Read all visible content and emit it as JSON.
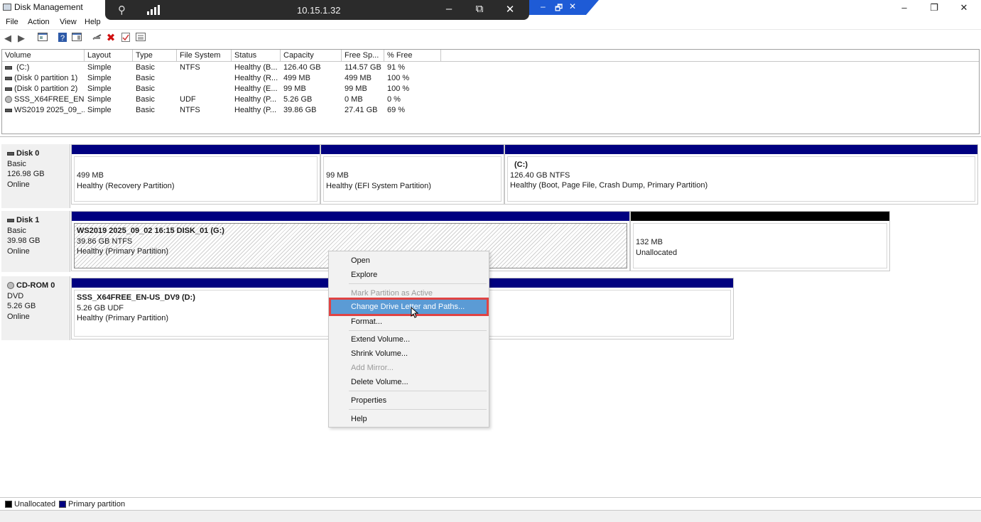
{
  "window": {
    "title": "Disk Management",
    "minimize": "–",
    "maximize": "❐",
    "close": "✕"
  },
  "remote_bar": {
    "host": "10.15.1.32",
    "pin_icon": "unpin-icon",
    "signal_icon": "signal-strength-icon",
    "minimize": "–",
    "restore": "⧉",
    "close": "✕"
  },
  "remote_tab": {
    "minimize": "–",
    "restore": "🗗",
    "close": "✕"
  },
  "menu": {
    "file": "File",
    "action": "Action",
    "view": "View",
    "help": "Help"
  },
  "toolbar": {
    "back": "◀",
    "forward": "▶",
    "delete": "✖"
  },
  "volume_list": {
    "headers": [
      "Volume",
      "Layout",
      "Type",
      "File System",
      "Status",
      "Capacity",
      "Free Sp...",
      "% Free"
    ],
    "rows": [
      {
        "volume": "(C:)",
        "layout": "Simple",
        "type": "Basic",
        "fs": "NTFS",
        "status": "Healthy (B...",
        "capacity": "126.40 GB",
        "free": "114.57 GB",
        "pct": "91 %"
      },
      {
        "volume": "(Disk 0 partition 1)",
        "layout": "Simple",
        "type": "Basic",
        "fs": "",
        "status": "Healthy (R...",
        "capacity": "499 MB",
        "free": "499 MB",
        "pct": "100 %"
      },
      {
        "volume": "(Disk 0 partition 2)",
        "layout": "Simple",
        "type": "Basic",
        "fs": "",
        "status": "Healthy (E...",
        "capacity": "99 MB",
        "free": "99 MB",
        "pct": "100 %"
      },
      {
        "volume": "SSS_X64FREE_EN-...",
        "layout": "Simple",
        "type": "Basic",
        "fs": "UDF",
        "status": "Healthy (P...",
        "capacity": "5.26 GB",
        "free": "0 MB",
        "pct": "0 %"
      },
      {
        "volume": "WS2019 2025_09_...",
        "layout": "Simple",
        "type": "Basic",
        "fs": "NTFS",
        "status": "Healthy (P...",
        "capacity": "39.86 GB",
        "free": "27.41 GB",
        "pct": "69 %"
      }
    ]
  },
  "disks": {
    "disk0": {
      "name": "Disk 0",
      "type": "Basic",
      "size": "126.98 GB",
      "state": "Online",
      "p1": {
        "size": "499 MB",
        "status": "Healthy (Recovery Partition)"
      },
      "p2": {
        "size": "99 MB",
        "status": "Healthy (EFI System Partition)"
      },
      "p3": {
        "name": "(C:)",
        "size": "126.40 GB NTFS",
        "status": "Healthy (Boot, Page File, Crash Dump, Primary Partition)"
      }
    },
    "disk1": {
      "name": "Disk 1",
      "type": "Basic",
      "size": "39.98 GB",
      "state": "Online",
      "p1": {
        "name": "WS2019 2025_09_02 16:15 DISK_01  (G:)",
        "size": "39.86 GB NTFS",
        "status": "Healthy (Primary Partition)"
      },
      "p2": {
        "size": "132 MB",
        "status": "Unallocated"
      }
    },
    "cdrom0": {
      "name": "CD-ROM 0",
      "type": "DVD",
      "size": "5.26 GB",
      "state": "Online",
      "p1": {
        "name": "SSS_X64FREE_EN-US_DV9  (D:)",
        "size": "5.26 GB UDF",
        "status": "Healthy (Primary Partition)"
      }
    }
  },
  "context_menu": {
    "open": "Open",
    "explore": "Explore",
    "mark_active": "Mark Partition as Active",
    "change_letter": "Change Drive Letter and Paths...",
    "format": "Format...",
    "extend": "Extend Volume...",
    "shrink": "Shrink Volume...",
    "add_mirror": "Add Mirror...",
    "delete": "Delete Volume...",
    "properties": "Properties",
    "help": "Help"
  },
  "legend": {
    "unallocated": "Unallocated",
    "primary": "Primary partition"
  },
  "colors": {
    "primary_partition": "#000080",
    "unallocated": "#000000",
    "highlight": "#5b9bd5",
    "highlight_border": "#e04343"
  }
}
